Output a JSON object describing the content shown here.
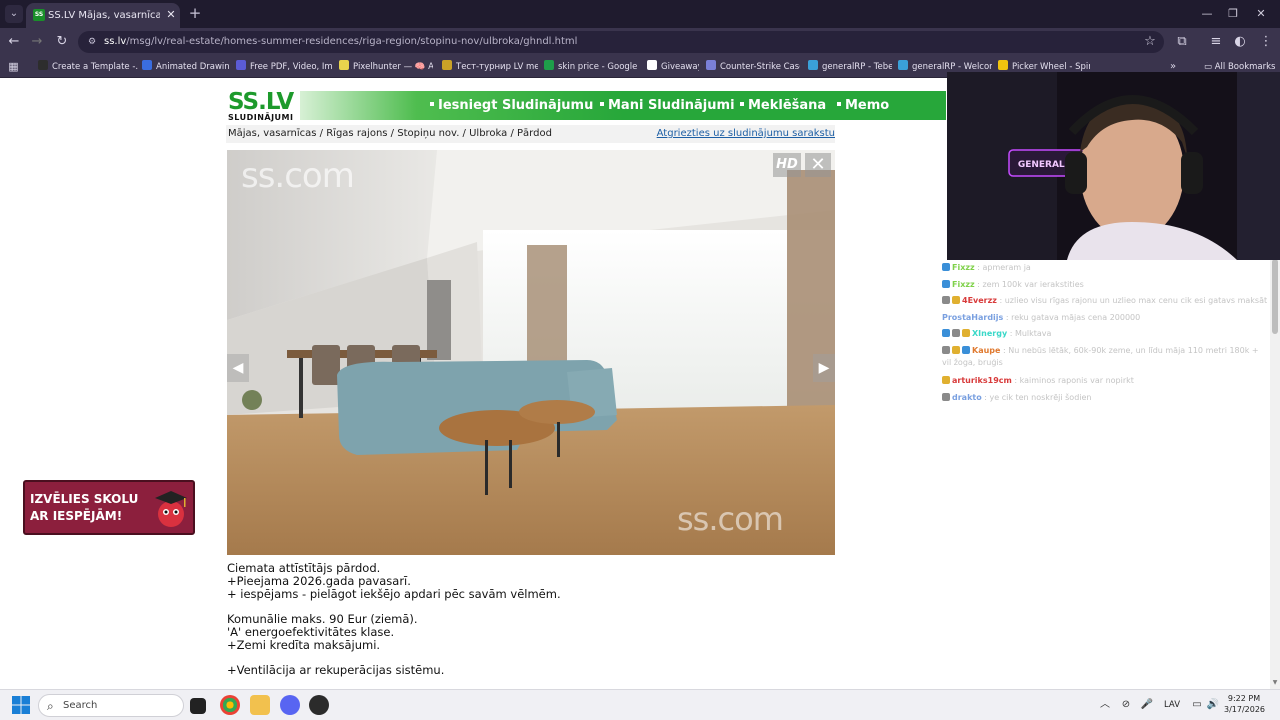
{
  "browser": {
    "tab_title": "SS.LV Mājas, vasarnīcas - Rīgas",
    "favicon_text": "SS",
    "url_host": "ss.lv",
    "url_path": "/msg/lv/real-estate/homes-summer-residences/riga-region/stopinu-nov/ulbroka/ghndl.html",
    "bookmarks": [
      {
        "label": "Create a Template -...",
        "color": "#2d2d2d"
      },
      {
        "label": "Animated Drawings",
        "color": "#3a6de0"
      },
      {
        "label": "Free PDF, Video, Im...",
        "color": "#5b5bd6"
      },
      {
        "label": "Pixelhunter — 🧠 A...",
        "color": "#e8d44d"
      },
      {
        "label": "Тест-турнир LV mei...",
        "color": "#c9a227"
      },
      {
        "label": "skin price - Google i...",
        "color": "#1e9e4a"
      },
      {
        "label": "Giveaway",
        "color": "#ffffff"
      },
      {
        "label": "Counter-Strike Case...",
        "color": "#7a7fd8"
      },
      {
        "label": "generalRP - Tebex",
        "color": "#3aa0d8"
      },
      {
        "label": "generalRP - Welcome",
        "color": "#3aa0d8"
      },
      {
        "label": "Picker Wheel - Spin...",
        "color": "#f1c40f"
      }
    ],
    "all_bookmarks": "All Bookmarks"
  },
  "site": {
    "logo_main": "SS.LV",
    "logo_sub": "SLUDINĀJUMI",
    "nav": [
      "Iesniegt Sludinājumu",
      "Mani Sludinājumi",
      "Meklēšana",
      "Memo"
    ],
    "breadcrumb": "Mājas, vasarnīcas / Rīgas rajons / Stopiņu nov. / Ulbroka / Pārdod",
    "back_link": "Atgriezties uz sludinājumu sarakstu",
    "photo": {
      "hd_label": "HD",
      "close": "✕",
      "prev": "◀",
      "next": "▶",
      "watermark": "ss.com"
    },
    "description": [
      "Ciemata attīstītājs pārdod.",
      "+Pieejama 2026.gada pavasarī.",
      "+ iespējams - pielāgot iekšējo apdari pēc savām vēlmēm.",
      "",
      "Komunālie maks. 90 Eur (ziemā).",
      "'A' energoefektivitātes klase.",
      "+Zemi kredīta maksājumi.",
      "",
      "+Ventilācija ar rekuperācijas sistēmu."
    ],
    "banner": {
      "line1": "IZVĒLIES SKOLU",
      "line2": "AR IESPĒJĀM!"
    }
  },
  "chat": [
    {
      "user": "Fixzz",
      "user_color": "#7fd14a",
      "text": ": apmeram ja",
      "badges": [
        "#3a8fd8"
      ]
    },
    {
      "user": "Fixzz",
      "user_color": "#7fd14a",
      "text": ": zem 100k var ierakstities",
      "badges": [
        "#3a8fd8"
      ]
    },
    {
      "user": "4Everzz",
      "user_color": "#d83a3a",
      "text": ": uzlieo visu rīgas rajonu un uzlieo max cenu cik esi gatavs maksāt",
      "badges": [
        "#8a8a8a",
        "#e0b030"
      ]
    },
    {
      "user": "ProstaHardijs",
      "user_color": "#7aa0e0",
      "text": ": reku gatava mājas cena 200000",
      "badges": []
    },
    {
      "user": "XInergy",
      "user_color": "#3ad8c8",
      "text": ": Mulktava",
      "badges": [
        "#3a8fd8",
        "#8a8a8a",
        "#e0b030"
      ]
    },
    {
      "user": "Kaupe",
      "user_color": "#e07a30",
      "text": ": Nu nebūs lētāk, 60k-90k zeme, un līdu māja 110 metri 180k + vil žoga, bruģis",
      "badges": [
        "#8a8a8a",
        "#e0b030",
        "#3a8fd8"
      ]
    },
    {
      "user": "arturiks19cm",
      "user_color": "#d83a3a",
      "text": ": kaiminos raponis var nopirkt",
      "badges": [
        "#e0b030"
      ]
    },
    {
      "user": "drakto",
      "user_color": "#7aa0e0",
      "text": ": ye cik ten noskrēji šodien",
      "badges": [
        "#8a8a8a"
      ]
    }
  ],
  "webcam": {
    "neon_sign": "GENERALRP"
  },
  "taskbar": {
    "search_label": "Search",
    "language": "LAV",
    "time": "9:22 PM",
    "date": "3/17/2026"
  }
}
